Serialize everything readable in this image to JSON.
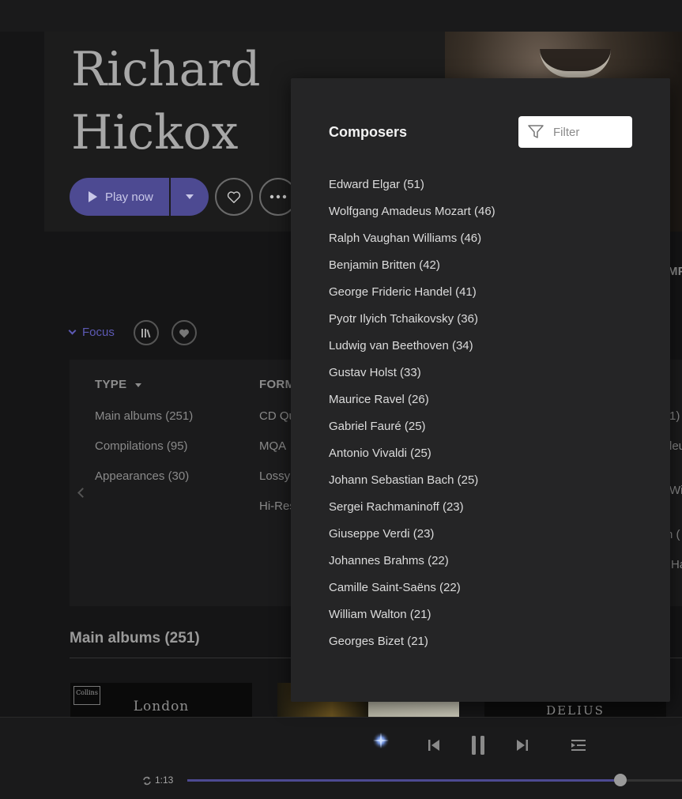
{
  "artist": {
    "name_line1": "Richard",
    "name_line2": "Hickox"
  },
  "actions": {
    "play_label": "Play now"
  },
  "focus": {
    "label": "Focus"
  },
  "filters": {
    "type": {
      "header": "TYPE",
      "items": [
        "Main albums (251)",
        "Compilations (95)",
        "Appearances (30)"
      ]
    },
    "format": {
      "header": "FORM",
      "items": [
        "CD Qu",
        "MQA",
        "Lossy",
        "Hi-Res"
      ]
    },
    "right_partial": {
      "header_fragment": "MP",
      "items": [
        "1)",
        "leu",
        "Wi",
        "n (",
        "Ha"
      ]
    }
  },
  "main_albums": {
    "title": "Main albums (251)",
    "covers": [
      {
        "logo": "Collins",
        "title": "London"
      },
      {
        "title": ""
      },
      {
        "title": "DELIUS"
      }
    ]
  },
  "player": {
    "elapsed": "1:13",
    "progress": 0.876
  },
  "composers_modal": {
    "title": "Composers",
    "filter_placeholder": "Filter",
    "items": [
      "Edward Elgar (51)",
      "Wolfgang Amadeus Mozart (46)",
      "Ralph Vaughan Williams (46)",
      "Benjamin Britten (42)",
      "George Frideric Handel (41)",
      "Pyotr Ilyich Tchaikovsky (36)",
      "Ludwig van Beethoven (34)",
      "Gustav Holst (33)",
      "Maurice Ravel (26)",
      "Gabriel Fauré (25)",
      "Antonio Vivaldi (25)",
      "Johann Sebastian Bach (25)",
      "Sergei Rachmaninoff (23)",
      "Giuseppe Verdi (23)",
      "Johannes Brahms (22)",
      "Camille Saint-Saëns (22)",
      "William Walton (21)",
      "Georges Bizet (21)"
    ]
  },
  "colors": {
    "accent": "#4d4a92",
    "focus": "#5d5ab5",
    "modal_bg": "#252526",
    "page_bg": "#151516"
  },
  "icons": [
    "play-icon",
    "chevron-down-icon",
    "heart-icon",
    "more-icon",
    "library-icon",
    "filter-icon",
    "previous-icon",
    "pause-icon",
    "next-icon",
    "queue-icon",
    "repeat-icon",
    "star-icon",
    "chevron-left-icon"
  ]
}
